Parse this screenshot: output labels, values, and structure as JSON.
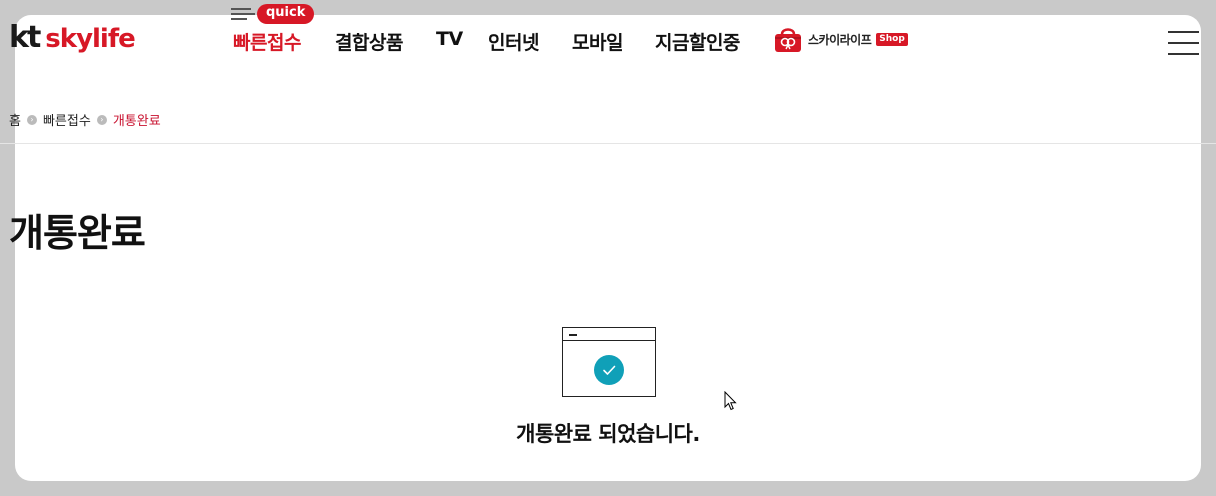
{
  "header": {
    "logo_kt": "kt",
    "logo_skylife": "skylife",
    "quick_badge": "quick",
    "nav": [
      {
        "label": "빠른접수",
        "active": true
      },
      {
        "label": "결합상품"
      },
      {
        "label": "TV"
      },
      {
        "label": "인터넷"
      },
      {
        "label": "모바일"
      },
      {
        "label": "지금할인중"
      }
    ],
    "shop_label": "스카이라이프",
    "shop_badge": "Shop",
    "menu_icon": "hamburger-icon",
    "shop_icon": "shopping-bag-icon"
  },
  "breadcrumb": [
    "홈",
    "빠른접수",
    "개통완료"
  ],
  "main": {
    "title": "개통완료",
    "message": "개통완료 되었습니다.",
    "illustration_icon": "window-check-icon"
  },
  "colors": {
    "brand_red": "#d71826",
    "check_teal": "#10a0b8",
    "background_gray": "#c9c9c9"
  }
}
